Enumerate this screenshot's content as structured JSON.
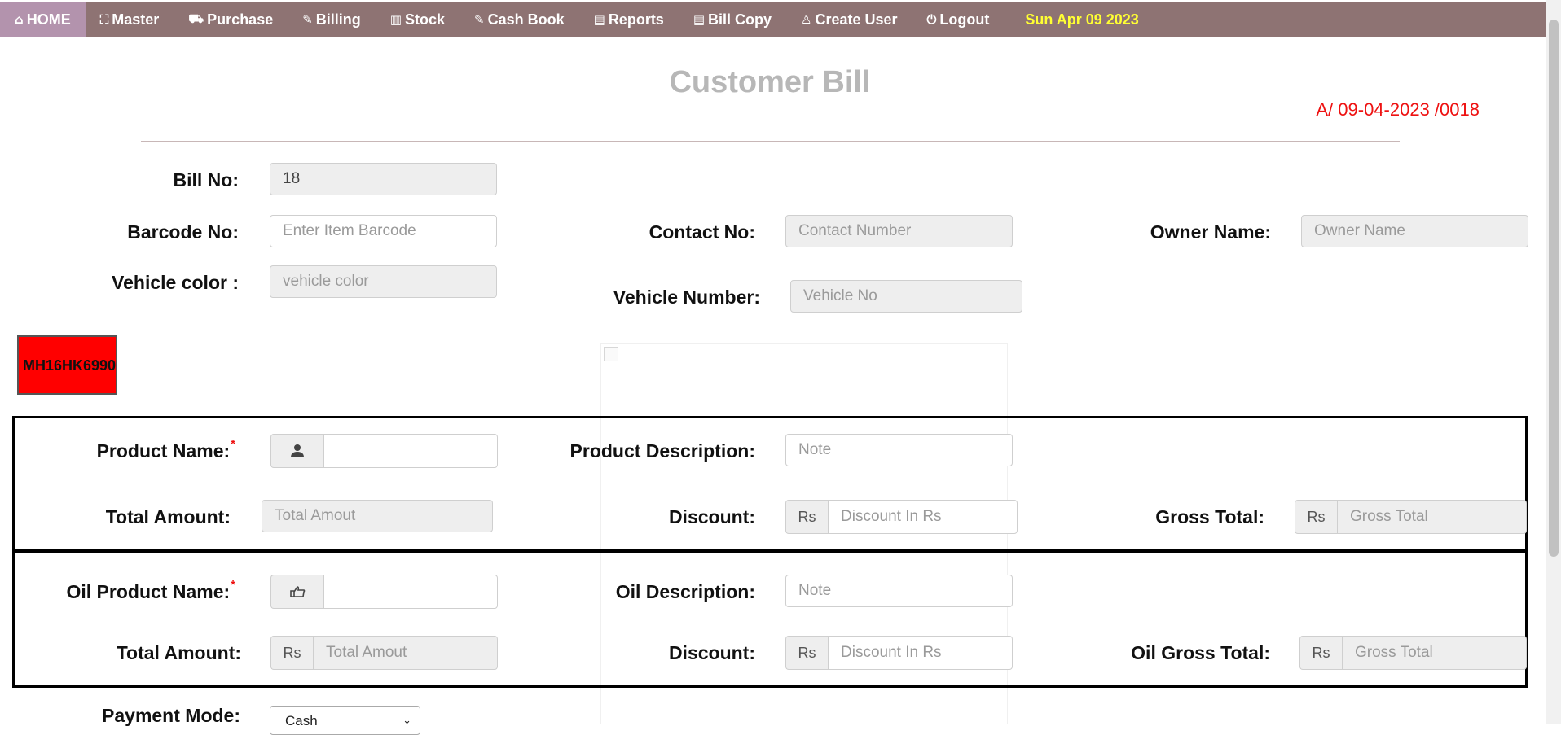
{
  "nav": {
    "items": [
      {
        "icon": "⌂",
        "label": "HOME"
      },
      {
        "icon": "⛶",
        "label": "Master"
      },
      {
        "icon": "⛟",
        "label": "Purchase"
      },
      {
        "icon": "✎",
        "label": "Billing"
      },
      {
        "icon": "▥",
        "label": "Stock"
      },
      {
        "icon": "✎",
        "label": "Cash Book"
      },
      {
        "icon": "▤",
        "label": "Reports"
      },
      {
        "icon": "▤",
        "label": "Bill Copy"
      },
      {
        "icon": "♙",
        "label": "Create User"
      },
      {
        "icon": "⏻",
        "label": "Logout"
      }
    ],
    "date": "Sun Apr 09 2023"
  },
  "header": {
    "title": "Customer Bill",
    "bill_code": "A/ 09-04-2023 /0018"
  },
  "form": {
    "bill_no_label": "Bill No:",
    "bill_no_value": "18",
    "barcode_label": "Barcode No:",
    "barcode_placeholder": "Enter Item Barcode",
    "contact_label": "Contact No:",
    "contact_placeholder": "Contact Number",
    "owner_label": "Owner Name:",
    "owner_placeholder": "Owner Name",
    "vehicle_color_label": "Vehicle color :",
    "vehicle_color_placeholder": "vehicle color",
    "vehicle_number_label": "Vehicle Number:",
    "vehicle_number_placeholder": "Vehicle No",
    "plate_text": "MH16HK6990"
  },
  "product": {
    "name_label": "Product Name:",
    "required_mark": "*",
    "desc_label": "Product Description:",
    "desc_placeholder": "Note",
    "total_label": "Total Amount:",
    "total_placeholder": "Total Amout",
    "discount_label": "Discount:",
    "discount_addon": "Rs",
    "discount_placeholder": "Discount In Rs",
    "gross_label": "Gross Total:",
    "gross_addon": "Rs",
    "gross_placeholder": "Gross Total"
  },
  "oil": {
    "name_label": "Oil Product Name:",
    "required_mark": "*",
    "desc_label": "Oil Description:",
    "desc_placeholder": "Note",
    "total_label": "Total Amount:",
    "total_addon": "Rs",
    "total_placeholder": "Total Amout",
    "discount_label": "Discount:",
    "discount_addon": "Rs",
    "discount_placeholder": "Discount In Rs",
    "gross_label": "Oil Gross Total:",
    "gross_addon": "Rs",
    "gross_placeholder": "Gross Total"
  },
  "payment": {
    "label": "Payment Mode:",
    "selected": "Cash"
  },
  "colors": {
    "navbar": "#8e7373",
    "nav_active": "#b393ad",
    "date": "#ffff33",
    "bill_code": "#ee1111",
    "plate": "#ff0000"
  }
}
